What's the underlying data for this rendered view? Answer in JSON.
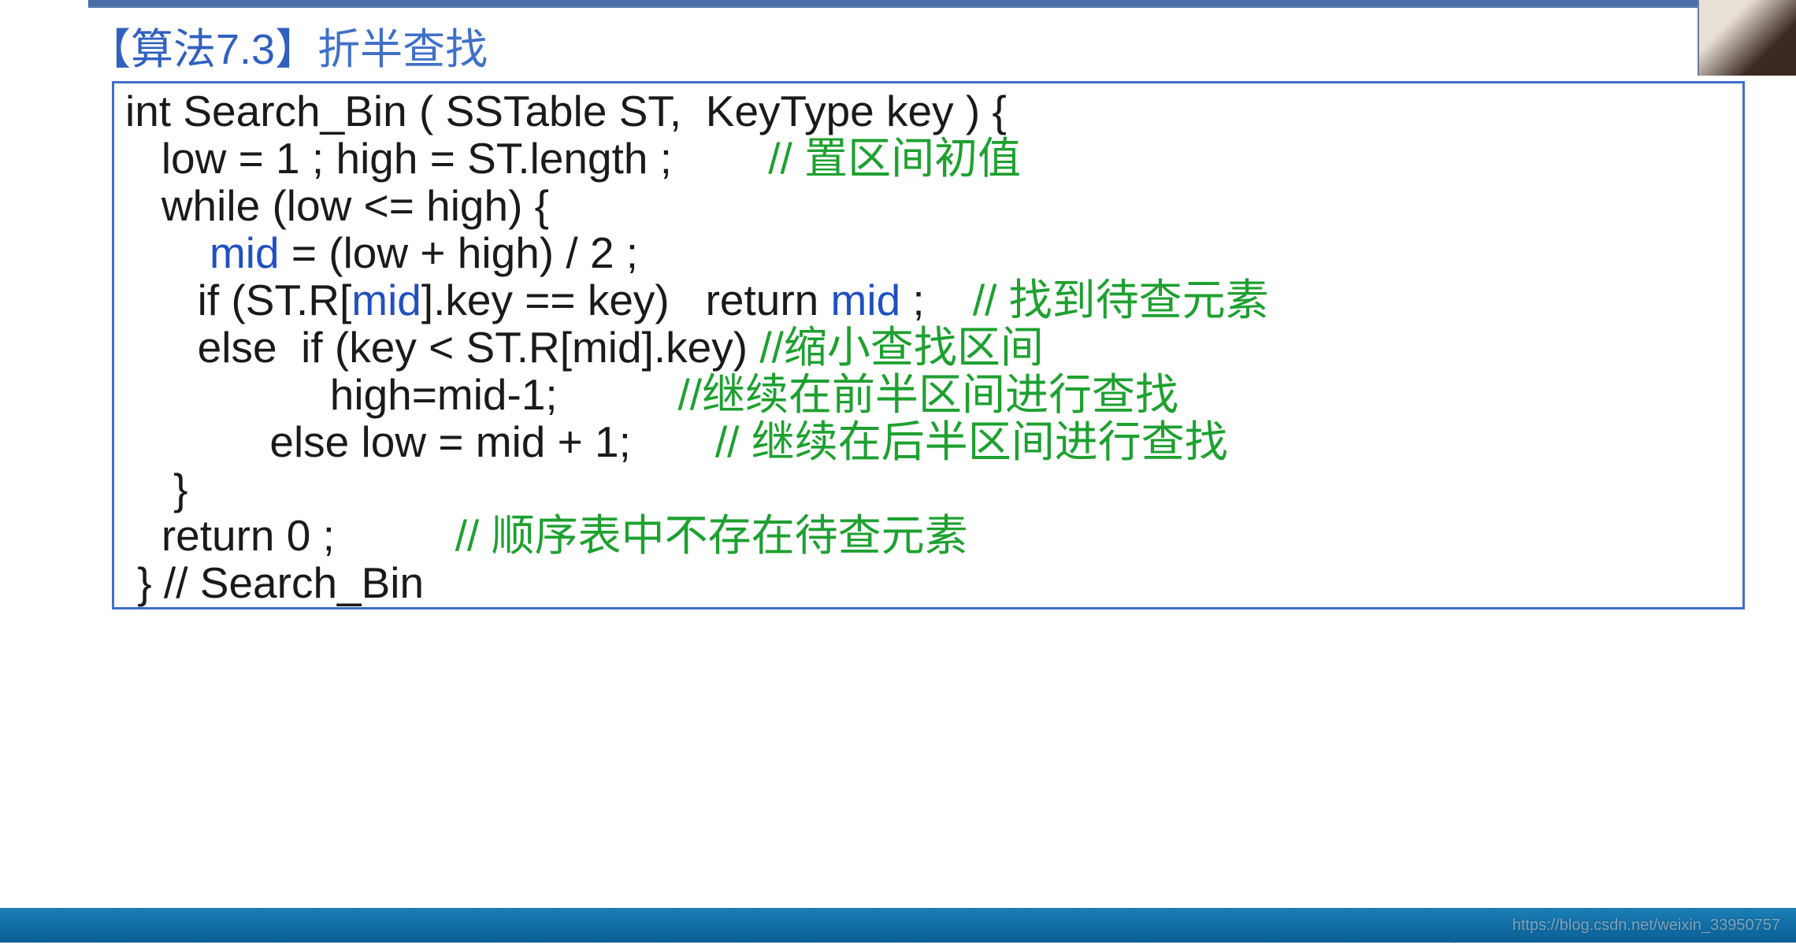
{
  "title": {
    "part1": "【算法7.3】",
    "part2": "折半查找"
  },
  "code": {
    "l1": "int Search_Bin ( SSTable ST,  KeyType key ) {",
    "l2a": "   low = 1 ; high = ST.length ;        ",
    "l2c": "// 置区间初值",
    "l3": "   while (low <= high) {",
    "l4a": "       ",
    "l4mid": "mid",
    "l4b": " = (low + high) / 2 ;",
    "l5a": "      if (ST.R[",
    "l5mid1": "mid",
    "l5b": "].key == key)   return ",
    "l5mid2": "mid",
    "l5c": " ;    ",
    "l5cmt": "// 找到待查元素",
    "l6a": "      else  if (key < ST.R[mid].key) ",
    "l6cmt": "//缩小查找区间",
    "l7a": "                 high=mid-1;          ",
    "l7cmt": "//继续在前半区间进行查找",
    "l8a": "            else low = mid + 1;       ",
    "l8cmt": "// 继续在后半区间进行查找",
    "l9": "    }",
    "l10a": "   return 0 ;          ",
    "l10cmt": "// 顺序表中不存在待查元素",
    "l11": " } // Search_Bin"
  },
  "watermark": "https://blog.csdn.net/weixin_33950757"
}
